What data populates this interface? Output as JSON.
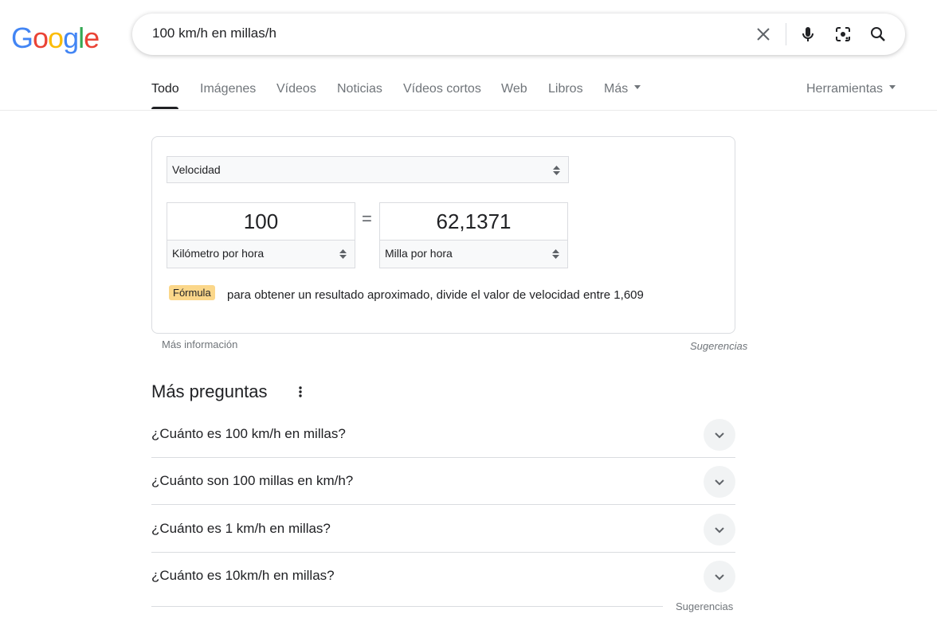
{
  "logo": {
    "letters": [
      "G",
      "o",
      "o",
      "g",
      "l",
      "e"
    ],
    "colors": [
      "#4285F4",
      "#EA4335",
      "#FBBC05",
      "#4285F4",
      "#34A853",
      "#EA4335"
    ]
  },
  "search": {
    "query": "100 km/h en millas/h"
  },
  "icons": {
    "clear": "close-icon",
    "mic": "microphone-icon",
    "lens": "camera-lens-icon",
    "search": "search-icon"
  },
  "tabs": [
    {
      "label": "Todo",
      "active": true
    },
    {
      "label": "Imágenes"
    },
    {
      "label": "Vídeos"
    },
    {
      "label": "Noticias"
    },
    {
      "label": "Vídeos cortos"
    },
    {
      "label": "Web"
    },
    {
      "label": "Libros"
    },
    {
      "label": "Más"
    }
  ],
  "tools_label": "Herramientas",
  "converter": {
    "category": "Velocidad",
    "left_value": "100",
    "right_value": "62,1371",
    "left_unit": "Kilómetro por hora",
    "right_unit": "Milla por hora",
    "equals": "=",
    "formula_label": "Fórmula",
    "formula_text": "para obtener un resultado aproximado, divide el valor de velocidad entre 1,609"
  },
  "more_info": "Más información",
  "feedback": "Sugerencias",
  "paa": {
    "title": "Más preguntas",
    "questions": [
      "¿Cuánto es 100 km/h en millas?",
      "¿Cuánto son 100 millas en km/h?",
      "¿Cuánto es 1 km/h en millas?",
      "¿Cuánto es 10km/h en millas?"
    ],
    "feedback": "Sugerencias"
  }
}
